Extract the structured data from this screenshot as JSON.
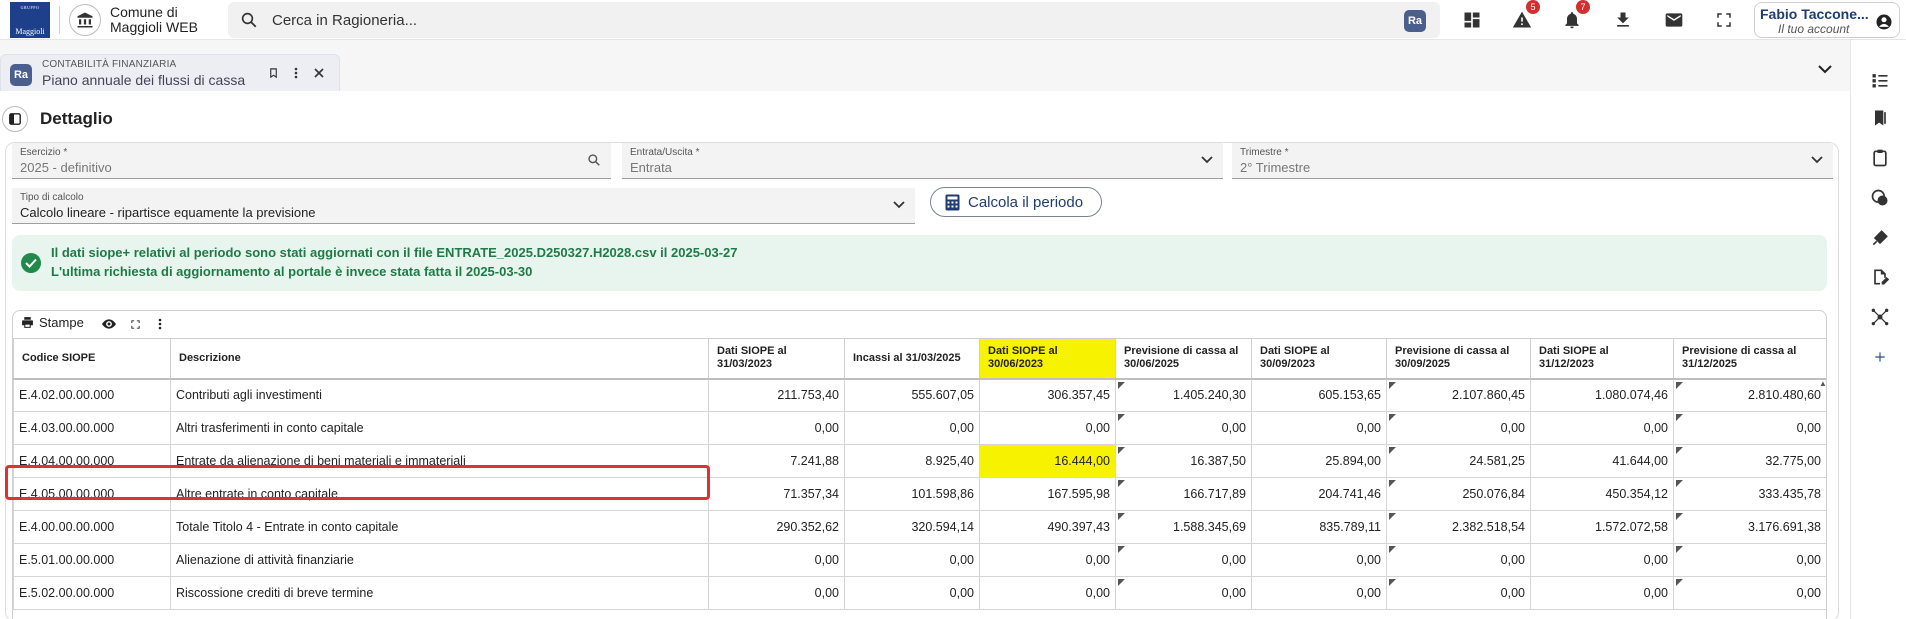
{
  "header": {
    "logo_top": "GRUPPO",
    "logo_text": "Maggioli",
    "app_title_line1": "Comune di",
    "app_title_line2": "Maggioli WEB",
    "search_placeholder": "Cerca in Ragioneria...",
    "search_badge": "Ra",
    "warning_count": "5",
    "notification_count": "7",
    "account_name": "Fabio Taccone...",
    "account_sub": "Il tuo account"
  },
  "tab": {
    "badge": "Ra",
    "category": "CONTABILITÀ FINANZIARIA",
    "title": "Piano annuale dei flussi di cassa"
  },
  "page": {
    "title": "Dettaglio"
  },
  "filters": {
    "esercizio": {
      "label": "Esercizio *",
      "value": "2025 - definitivo"
    },
    "entrata_uscita": {
      "label": "Entrata/Uscita *",
      "value": "Entrata"
    },
    "trimestre": {
      "label": "Trimestre *",
      "value": "2° Trimestre"
    },
    "tipo_calcolo": {
      "label": "Tipo di calcolo",
      "value": "Calcolo lineare - ripartisce equamente la previsione"
    },
    "calc_button": "Calcola il periodo"
  },
  "alert": {
    "line1": "Il dati siope+ relativi al periodo sono stati aggiornati con il file ENTRATE_2025.D250327.H2028.csv il 2025-03-27",
    "line2": "L'ultima richiesta di aggiornamento al portale è invece stata fatta il 2025-03-30",
    "color": "#1f7a45"
  },
  "toolbar": {
    "print_label": "Stampe"
  },
  "table": {
    "headers": [
      "Codice SIOPE",
      "Descrizione",
      "Dati SIOPE al 31/03/2023",
      "Incassi al 31/03/2025",
      "Dati SIOPE al 30/06/2023",
      "Previsione di cassa al 30/06/2025",
      "Dati SIOPE al 30/09/2023",
      "Previsione di cassa al 30/09/2025",
      "Dati SIOPE al 31/12/2023",
      "Previsione di cassa al 31/12/2025"
    ],
    "highlight_color": "#f7f200",
    "rows": [
      [
        "E.4.02.00.00.000",
        "Contributi agli investimenti",
        "211.753,40",
        "555.607,05",
        "306.357,45",
        "1.405.240,30",
        "605.153,65",
        "2.107.860,45",
        "1.080.074,46",
        "2.810.480,60"
      ],
      [
        "E.4.03.00.00.000",
        "Altri trasferimenti in conto capitale",
        "0,00",
        "0,00",
        "0,00",
        "0,00",
        "0,00",
        "0,00",
        "0,00",
        "0,00"
      ],
      [
        "E.4.04.00.00.000",
        "Entrate da alienazione di beni materiali e immateriali",
        "7.241,88",
        "8.925,40",
        "16.444,00",
        "16.387,50",
        "25.894,00",
        "24.581,25",
        "41.644,00",
        "32.775,00"
      ],
      [
        "E.4.05.00.00.000",
        "Altre entrate in conto capitale",
        "71.357,34",
        "101.598,86",
        "167.595,98",
        "166.717,89",
        "204.741,46",
        "250.076,84",
        "450.354,12",
        "333.435,78"
      ],
      [
        "E.4.00.00.00.000",
        "Totale Titolo 4 - Entrate in conto capitale",
        "290.352,62",
        "320.594,14",
        "490.397,43",
        "1.588.345,69",
        "835.789,11",
        "2.382.518,54",
        "1.572.072,58",
        "3.176.691,38"
      ],
      [
        "E.5.01.00.00.000",
        "Alienazione di attività finanziarie",
        "0,00",
        "0,00",
        "0,00",
        "0,00",
        "0,00",
        "0,00",
        "0,00",
        "0,00"
      ],
      [
        "E.5.02.00.00.000",
        "Riscossione crediti di breve termine",
        "0,00",
        "0,00",
        "0,00",
        "0,00",
        "0,00",
        "0,00",
        "0,00",
        "0,00"
      ]
    ]
  }
}
